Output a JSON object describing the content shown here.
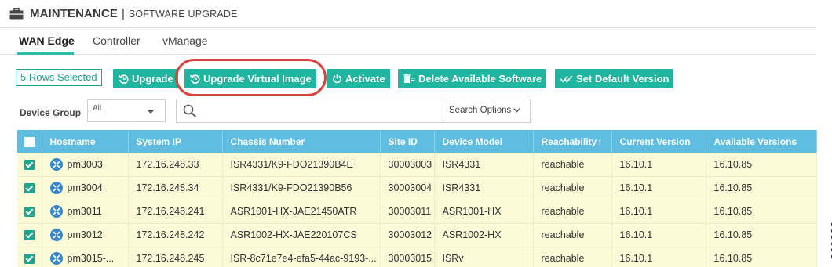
{
  "header": {
    "title": "MAINTENANCE",
    "separator": "|",
    "subtitle": "SOFTWARE UPGRADE",
    "icon": "briefcase-icon"
  },
  "tabs": [
    {
      "label": "WAN Edge",
      "active": true
    },
    {
      "label": "Controller",
      "active": false
    },
    {
      "label": "vManage",
      "active": false
    }
  ],
  "toolbar": {
    "rows_selected": "5 Rows Selected",
    "buttons": [
      {
        "label": "Upgrade",
        "icon": "upgrade-icon"
      },
      {
        "label": "Upgrade Virtual Image",
        "icon": "upgrade-icon"
      },
      {
        "label": "Activate",
        "icon": "power-icon"
      },
      {
        "label": "Delete Available Software",
        "icon": "delete-software-icon"
      },
      {
        "label": "Set Default Version",
        "icon": "double-check-icon"
      }
    ]
  },
  "filters": {
    "device_group_label": "Device Group",
    "device_group_value": "All",
    "search_placeholder": "",
    "search_options_label": "Search Options"
  },
  "table": {
    "columns": [
      "Hostname",
      "System IP",
      "Chassis Number",
      "Site ID",
      "Device Model",
      "Reachability",
      "Current Version",
      "Available Versions"
    ],
    "sort_indicator": "↑",
    "rows": [
      {
        "hostname": "pm3003",
        "system_ip": "172.16.248.33",
        "chassis": "ISR4331/K9-FDO21390B4E",
        "site_id": "30003003",
        "model": "ISR4331",
        "reachability": "reachable",
        "current": "16.10.1",
        "available": "16.10.85",
        "checked": true
      },
      {
        "hostname": "pm3004",
        "system_ip": "172.16.248.34",
        "chassis": "ISR4331/K9-FDO21390B56",
        "site_id": "30003004",
        "model": "ISR4331",
        "reachability": "reachable",
        "current": "16.10.1",
        "available": "16.10.85",
        "checked": true
      },
      {
        "hostname": "pm3011",
        "system_ip": "172.16.248.241",
        "chassis": "ASR1001-HX-JAE21450ATR",
        "site_id": "30003011",
        "model": "ASR1001-HX",
        "reachability": "reachable",
        "current": "16.10.1",
        "available": "16.10.85",
        "checked": true
      },
      {
        "hostname": "pm3012",
        "system_ip": "172.16.248.242",
        "chassis": "ASR1002-HX-JAE220107CS",
        "site_id": "30003012",
        "model": "ASR1002-HX",
        "reachability": "reachable",
        "current": "16.10.1",
        "available": "16.10.85",
        "checked": true
      },
      {
        "hostname": "pm3015-...",
        "system_ip": "172.16.248.245",
        "chassis": "ISR-8c71e7e4-efa5-44ac-9193-...",
        "site_id": "30003015",
        "model": "ISRv",
        "reachability": "reachable",
        "current": "16.10.1",
        "available": "16.10.85",
        "checked": true
      }
    ]
  },
  "figure_id": "369290",
  "colors": {
    "accent": "#1fb59e",
    "header_blue": "#5fbde2",
    "row_highlight": "#fbfbd8",
    "callout_ring": "#d9433f"
  }
}
